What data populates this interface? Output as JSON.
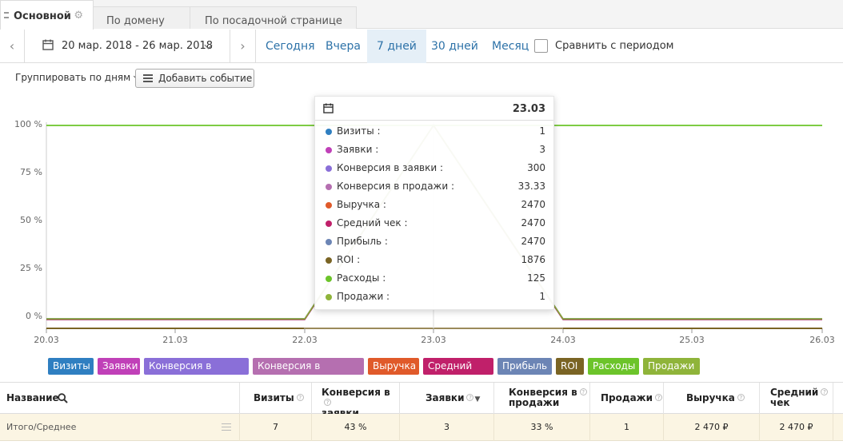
{
  "tabs": [
    {
      "label": "Основной",
      "active": true
    },
    {
      "label": "По домену",
      "active": false
    },
    {
      "label": "По посадочной странице",
      "active": false
    }
  ],
  "period": {
    "date_range": "20 мар. 2018 - 26 мар. 2018",
    "presets": [
      "Сегодня",
      "Вчера",
      "7 дней",
      "30 дней",
      "Месяц"
    ],
    "active_preset": "7 дней",
    "compare_label": "Сравнить с периодом",
    "compare_checked": false
  },
  "toolbar": {
    "group_by": "Группировать по дням",
    "add_event": "Добавить событие"
  },
  "chart_data": {
    "type": "line",
    "x": [
      "20.03",
      "21.03",
      "22.03",
      "23.03",
      "24.03",
      "25.03",
      "26.03"
    ],
    "y_ticks": [
      "100 %",
      "75 %",
      "50 %",
      "25 %",
      "0 %"
    ],
    "ylim": [
      0,
      100
    ],
    "series": [
      {
        "name": "Визиты",
        "color": "#2f7fc1",
        "values": [
          0,
          0,
          0,
          1,
          0,
          0,
          0
        ]
      },
      {
        "name": "Заявки",
        "color": "#c040b8",
        "values": [
          0,
          0,
          0,
          3,
          0,
          0,
          0
        ]
      },
      {
        "name": "Конверсия в заявки",
        "color": "#8a6fd8",
        "values": [
          0,
          0,
          0,
          300,
          0,
          0,
          0
        ]
      },
      {
        "name": "Конверсия в продажи",
        "color": "#b56fb0",
        "values": [
          0,
          0,
          0,
          33.33,
          0,
          0,
          0
        ]
      },
      {
        "name": "Выручка",
        "color": "#e05a2a",
        "values": [
          0,
          0,
          0,
          2470,
          0,
          0,
          0
        ]
      },
      {
        "name": "Средний чек",
        "color": "#c0206a",
        "values": [
          0,
          0,
          0,
          2470,
          0,
          0,
          0
        ]
      },
      {
        "name": "Прибыль",
        "color": "#6c85b5",
        "values": [
          0,
          0,
          0,
          2470,
          0,
          0,
          0
        ]
      },
      {
        "name": "ROI",
        "color": "#7a6424",
        "values": [
          0,
          0,
          0,
          1876,
          0,
          0,
          0
        ]
      },
      {
        "name": "Расходы",
        "color": "#6cc42a",
        "values": [
          100,
          100,
          100,
          100,
          100,
          100,
          100
        ]
      },
      {
        "name": "Продажи",
        "color": "#8fb43a",
        "values": [
          0,
          0,
          0,
          1,
          0,
          0,
          0
        ]
      }
    ],
    "legend_placement": "bottom",
    "grid": false
  },
  "tooltip": {
    "date": "23.03",
    "rows": [
      {
        "label": "Визиты :",
        "value": "1",
        "color": "#2f7fc1"
      },
      {
        "label": "Заявки :",
        "value": "3",
        "color": "#c040b8"
      },
      {
        "label": "Конверсия в заявки :",
        "value": "300",
        "color": "#8a6fd8"
      },
      {
        "label": "Конверсия в продажи :",
        "value": "33.33",
        "color": "#b56fb0"
      },
      {
        "label": "Выручка :",
        "value": "2470",
        "color": "#e05a2a"
      },
      {
        "label": "Средний чек :",
        "value": "2470",
        "color": "#c0206a"
      },
      {
        "label": "Прибыль :",
        "value": "2470",
        "color": "#6c85b5"
      },
      {
        "label": "ROI :",
        "value": "1876",
        "color": "#7a6424"
      },
      {
        "label": "Расходы :",
        "value": "125",
        "color": "#6cc42a"
      },
      {
        "label": "Продажи :",
        "value": "1",
        "color": "#8fb43a"
      }
    ]
  },
  "table": {
    "headers": {
      "name": "Название",
      "visits": "Визиты",
      "conv_leads_1": "Конверсия в",
      "conv_leads_2": "заявки",
      "leads": "Заявки",
      "conv_sales_1": "Конверсия в",
      "conv_sales_2": "продажи",
      "sales": "Продажи",
      "revenue": "Выручка",
      "avg_check_1": "Средний",
      "avg_check_2": "чек"
    },
    "totals": {
      "name": "Итого/Среднее",
      "visits": "7",
      "conv_leads": "43 %",
      "leads": "3",
      "conv_sales": "33 %",
      "sales": "1",
      "revenue": "2 470 ₽",
      "avg_check": "2 470 ₽"
    }
  }
}
